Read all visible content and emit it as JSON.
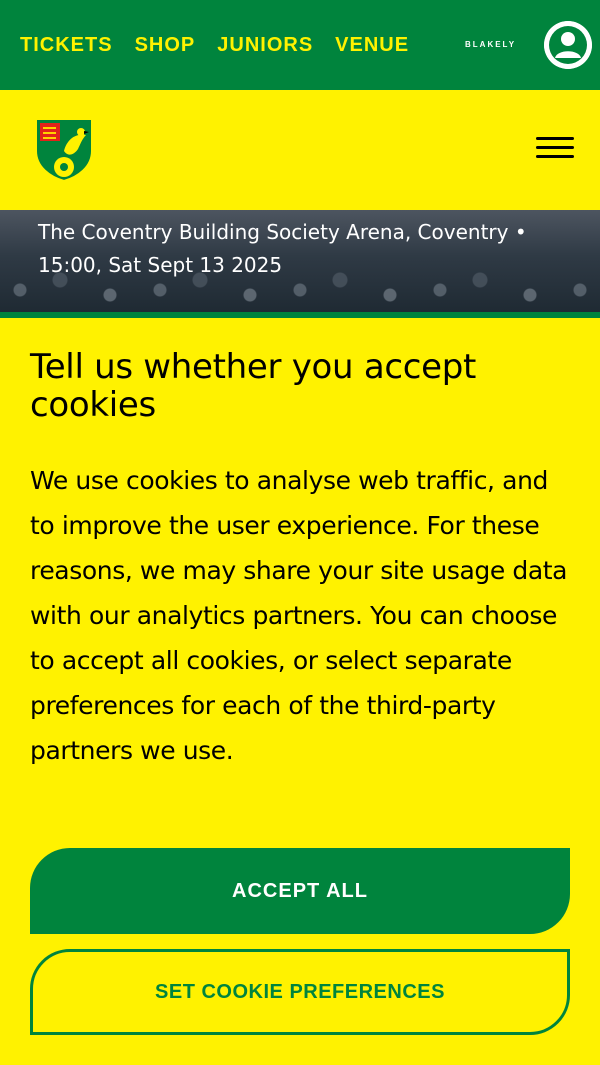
{
  "colors": {
    "brand_green": "#00843D",
    "brand_yellow": "#FFF200",
    "text_dark": "#000000",
    "text_light": "#FFFFFF"
  },
  "topnav": {
    "items": [
      {
        "label": "TICKETS"
      },
      {
        "label": "SHOP"
      },
      {
        "label": "JUNIORS"
      },
      {
        "label": "VENUE"
      }
    ],
    "sponsor_label": "BLAKELY",
    "account_icon": "user-account-icon"
  },
  "header": {
    "logo_icon": "club-crest-logo",
    "menu_icon": "hamburger-menu-icon"
  },
  "fixture": {
    "venue_datetime": "The Coventry Building Society Arena, Coventry • 15:00, Sat Sept 13 2025"
  },
  "cookie_banner": {
    "title": "Tell us whether you accept cookies",
    "body": "We use cookies to analyse web traffic, and to improve the user experience. For these reasons, we may share your site usage data with our analytics partners. You can choose to accept all cookies, or select separate preferences for each of the third-party partners we use.",
    "accept_label": "ACCEPT ALL",
    "preferences_label": "SET COOKIE PREFERENCES"
  }
}
